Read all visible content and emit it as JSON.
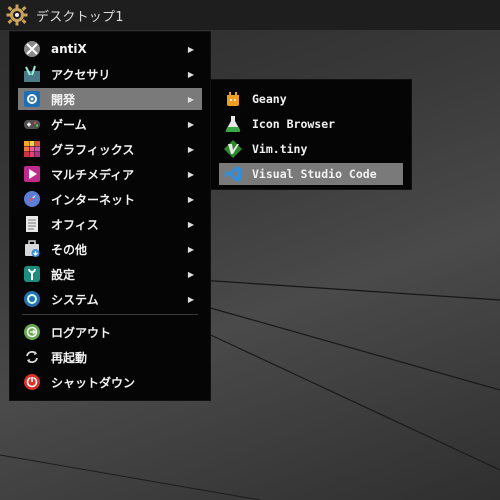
{
  "topbar": {
    "title": "デスクトップ1",
    "logo_icon": "antix-gear-logo-icon"
  },
  "main_menu": {
    "items": [
      {
        "label": "antiX",
        "icon": "antix-icon",
        "submenu": true
      },
      {
        "label": "アクセサリ",
        "icon": "accessories-icon",
        "submenu": true
      },
      {
        "label": "開発",
        "icon": "development-icon",
        "submenu": true,
        "active": true
      },
      {
        "label": "ゲーム",
        "icon": "gamepad-icon",
        "submenu": true
      },
      {
        "label": "グラフィックス",
        "icon": "graphics-icon",
        "submenu": true
      },
      {
        "label": "マルチメディア",
        "icon": "multimedia-icon",
        "submenu": true
      },
      {
        "label": "インターネット",
        "icon": "internet-icon",
        "submenu": true
      },
      {
        "label": "オフィス",
        "icon": "office-icon",
        "submenu": true
      },
      {
        "label": "その他",
        "icon": "other-icon",
        "submenu": true
      },
      {
        "label": "設定",
        "icon": "settings-icon",
        "submenu": true
      },
      {
        "label": "システム",
        "icon": "system-icon",
        "submenu": true
      }
    ],
    "bottom_items": [
      {
        "label": "ログアウト",
        "icon": "logout-icon"
      },
      {
        "label": "再起動",
        "icon": "reboot-icon"
      },
      {
        "label": "シャットダウン",
        "icon": "shutdown-icon"
      }
    ],
    "arrow": "▶"
  },
  "sub_menu": {
    "items": [
      {
        "label": "Geany",
        "icon": "geany-icon"
      },
      {
        "label": "Icon Browser",
        "icon": "icon-browser-icon"
      },
      {
        "label": "Vim.tiny",
        "icon": "vim-icon"
      },
      {
        "label": "Visual Studio Code",
        "icon": "vscode-icon",
        "active": true
      }
    ]
  }
}
